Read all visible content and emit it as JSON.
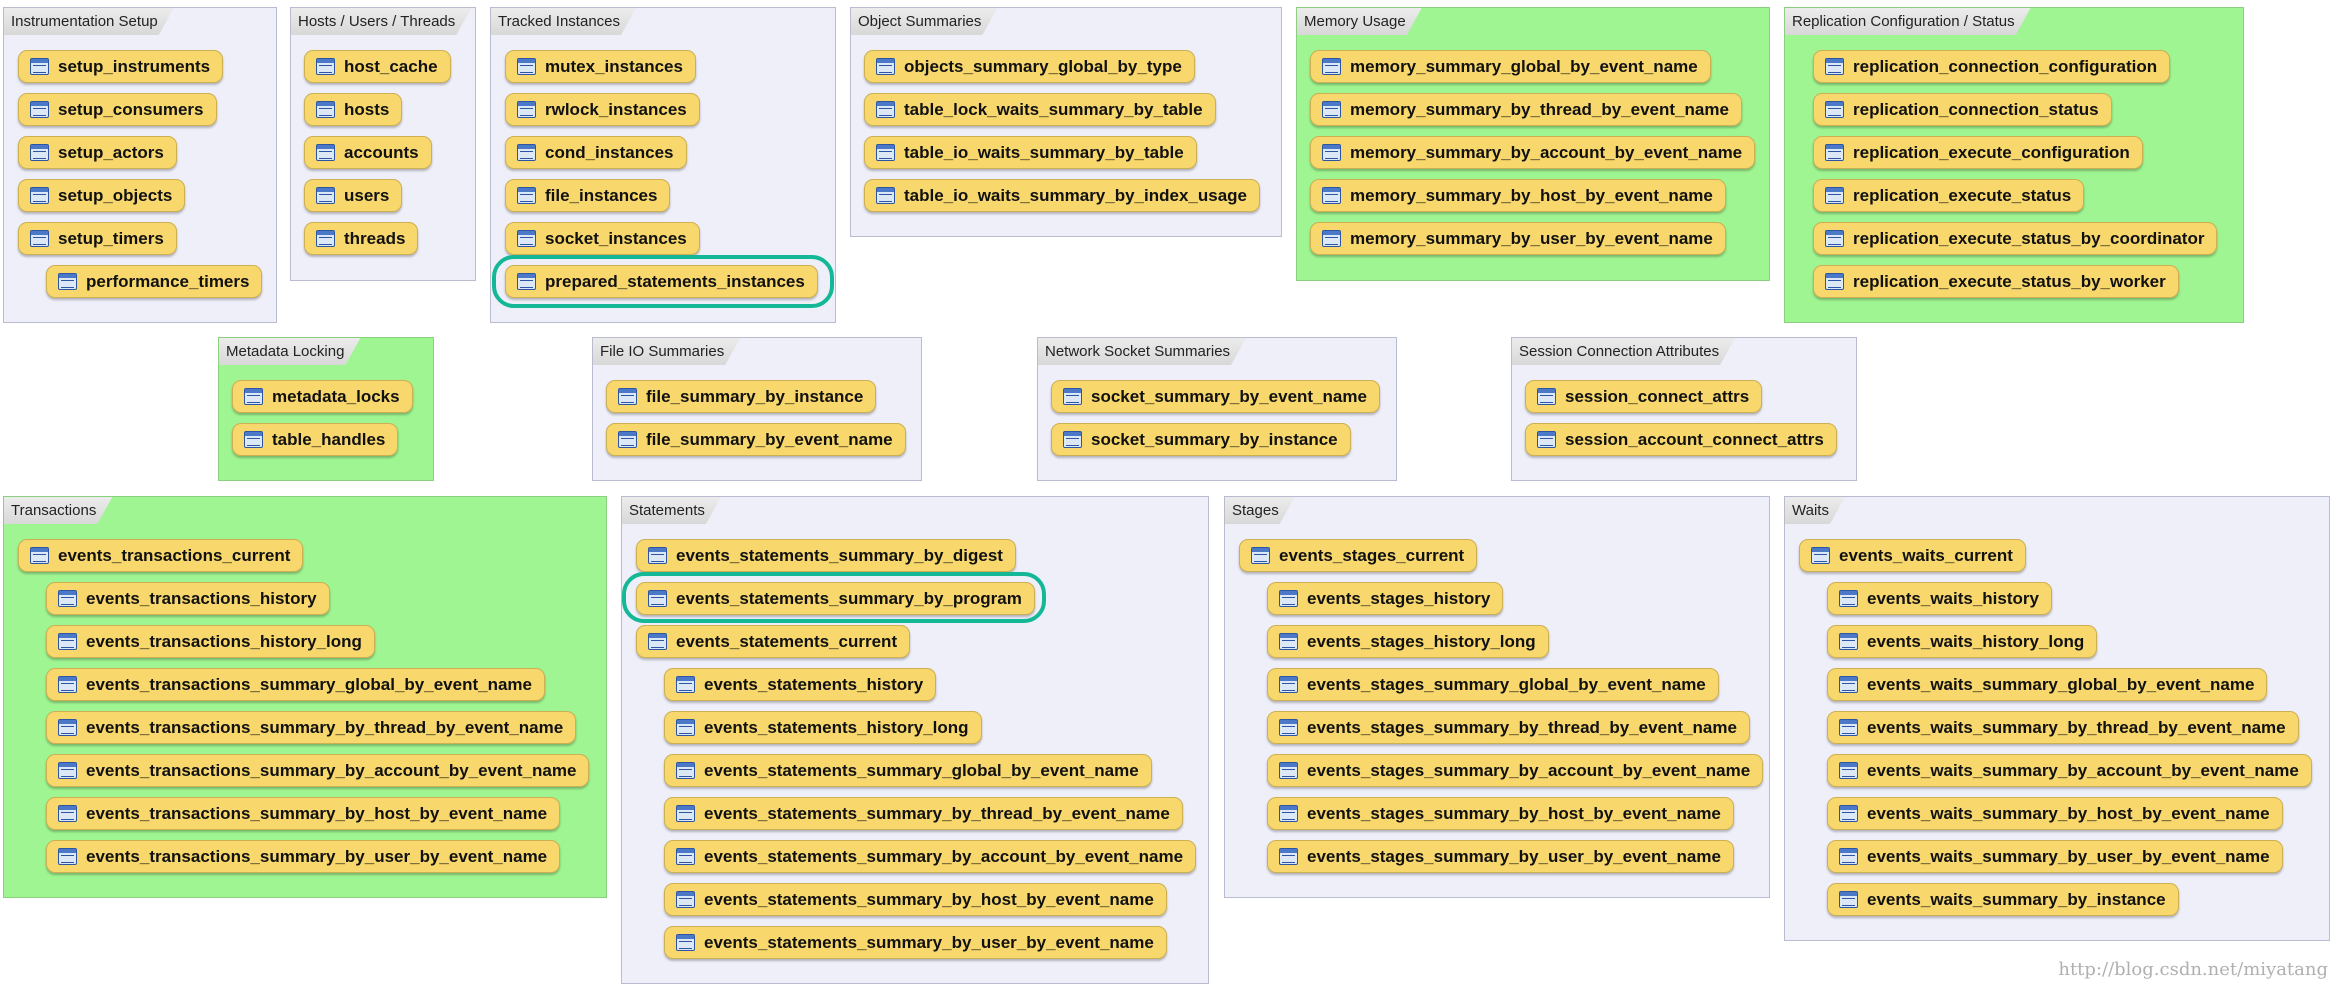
{
  "groups": {
    "instrumentation_setup": {
      "title": "Instrumentation Setup",
      "items": [
        "setup_instruments",
        "setup_consumers",
        "setup_actors",
        "setup_objects",
        "setup_timers",
        "performance_timers"
      ]
    },
    "hosts_users_threads": {
      "title": "Hosts / Users / Threads",
      "items": [
        "host_cache",
        "hosts",
        "accounts",
        "users",
        "threads"
      ]
    },
    "tracked_instances": {
      "title": "Tracked Instances",
      "items": [
        "mutex_instances",
        "rwlock_instances",
        "cond_instances",
        "file_instances",
        "socket_instances",
        "prepared_statements_instances"
      ]
    },
    "object_summaries": {
      "title": "Object Summaries",
      "items": [
        "objects_summary_global_by_type",
        "table_lock_waits_summary_by_table",
        "table_io_waits_summary_by_table",
        "table_io_waits_summary_by_index_usage"
      ]
    },
    "memory_usage": {
      "title": "Memory Usage",
      "items": [
        "memory_summary_global_by_event_name",
        "memory_summary_by_thread_by_event_name",
        "memory_summary_by_account_by_event_name",
        "memory_summary_by_host_by_event_name",
        "memory_summary_by_user_by_event_name"
      ]
    },
    "replication": {
      "title": "Replication Configuration / Status",
      "items": [
        "replication_connection_configuration",
        "replication_connection_status",
        "replication_execute_configuration",
        "replication_execute_status",
        "replication_execute_status_by_coordinator",
        "replication_execute_status_by_worker"
      ]
    },
    "metadata_locking": {
      "title": "Metadata Locking",
      "items": [
        "metadata_locks",
        "table_handles"
      ]
    },
    "file_io_summaries": {
      "title": "File IO Summaries",
      "items": [
        "file_summary_by_instance",
        "file_summary_by_event_name"
      ]
    },
    "network_socket_summaries": {
      "title": "Network Socket Summaries",
      "items": [
        "socket_summary_by_event_name",
        "socket_summary_by_instance"
      ]
    },
    "session_connection_attributes": {
      "title": "Session Connection Attributes",
      "items": [
        "session_connect_attrs",
        "session_account_connect_attrs"
      ]
    },
    "transactions": {
      "title": "Transactions",
      "items": [
        "events_transactions_current",
        "events_transactions_history",
        "events_transactions_history_long",
        "events_transactions_summary_global_by_event_name",
        "events_transactions_summary_by_thread_by_event_name",
        "events_transactions_summary_by_account_by_event_name",
        "events_transactions_summary_by_host_by_event_name",
        "events_transactions_summary_by_user_by_event_name"
      ]
    },
    "statements": {
      "title": "Statements",
      "items": [
        "events_statements_summary_by_digest",
        "events_statements_summary_by_program",
        "events_statements_current",
        "events_statements_history",
        "events_statements_history_long",
        "events_statements_summary_global_by_event_name",
        "events_statements_summary_by_thread_by_event_name",
        "events_statements_summary_by_account_by_event_name",
        "events_statements_summary_by_host_by_event_name",
        "events_statements_summary_by_user_by_event_name"
      ]
    },
    "stages": {
      "title": "Stages",
      "items": [
        "events_stages_current",
        "events_stages_history",
        "events_stages_history_long",
        "events_stages_summary_global_by_event_name",
        "events_stages_summary_by_thread_by_event_name",
        "events_stages_summary_by_account_by_event_name",
        "events_stages_summary_by_host_by_event_name",
        "events_stages_summary_by_user_by_event_name"
      ]
    },
    "waits": {
      "title": "Waits",
      "items": [
        "events_waits_current",
        "events_waits_history",
        "events_waits_history_long",
        "events_waits_summary_global_by_event_name",
        "events_waits_summary_by_thread_by_event_name",
        "events_waits_summary_by_account_by_event_name",
        "events_waits_summary_by_host_by_event_name",
        "events_waits_summary_by_user_by_event_name",
        "events_waits_summary_by_instance"
      ]
    }
  },
  "watermark": "http://blog.csdn.net/miyatang",
  "colors": {
    "group_default": "#eeeff9",
    "group_green": "#9ff591",
    "pill": "#f8d86c",
    "highlight": "#14b896"
  }
}
